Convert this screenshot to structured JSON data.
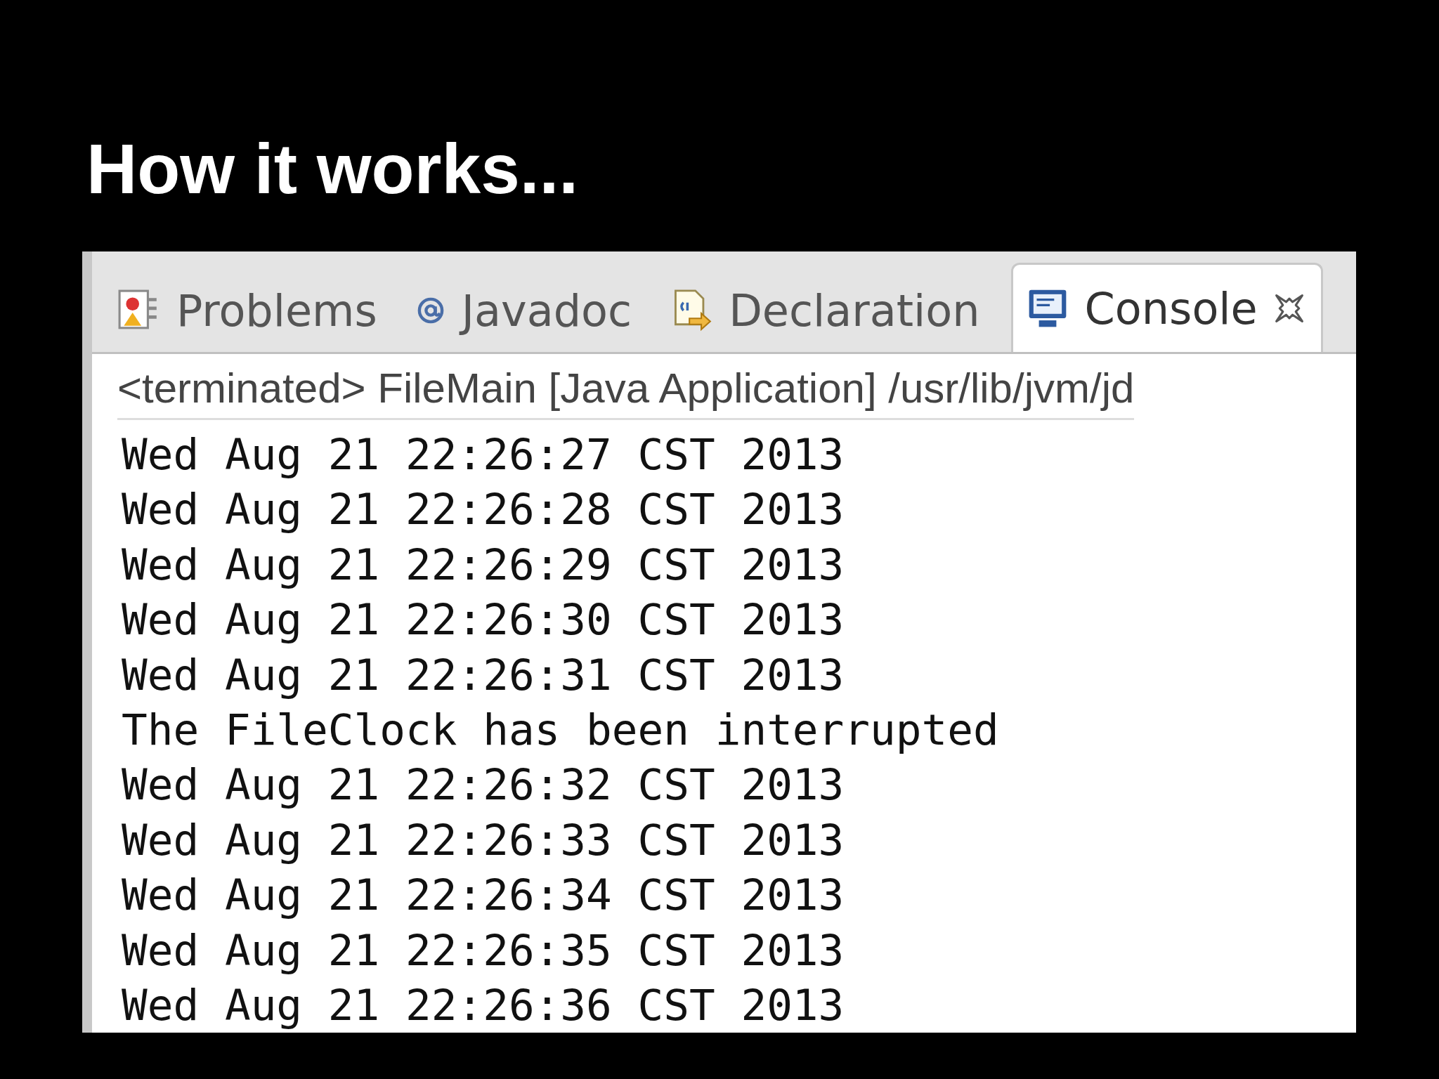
{
  "slide": {
    "title": "How it works..."
  },
  "tabs": [
    {
      "label": "Problems",
      "kind": "problems",
      "selected": false
    },
    {
      "label": "Javadoc",
      "kind": "javadoc",
      "selected": false
    },
    {
      "label": "Declaration",
      "kind": "declaration",
      "selected": false
    },
    {
      "label": "Console",
      "kind": "console",
      "selected": true
    }
  ],
  "console": {
    "header": "<terminated> FileMain [Java Application] /usr/lib/jvm/jd",
    "lines": [
      "Wed Aug 21 22:26:27 CST 2013",
      "Wed Aug 21 22:26:28 CST 2013",
      "Wed Aug 21 22:26:29 CST 2013",
      "Wed Aug 21 22:26:30 CST 2013",
      "Wed Aug 21 22:26:31 CST 2013",
      "The FileClock has been interrupted",
      "Wed Aug 21 22:26:32 CST 2013",
      "Wed Aug 21 22:26:33 CST 2013",
      "Wed Aug 21 22:26:34 CST 2013",
      "Wed Aug 21 22:26:35 CST 2013",
      "Wed Aug 21 22:26:36 CST 2013"
    ]
  }
}
